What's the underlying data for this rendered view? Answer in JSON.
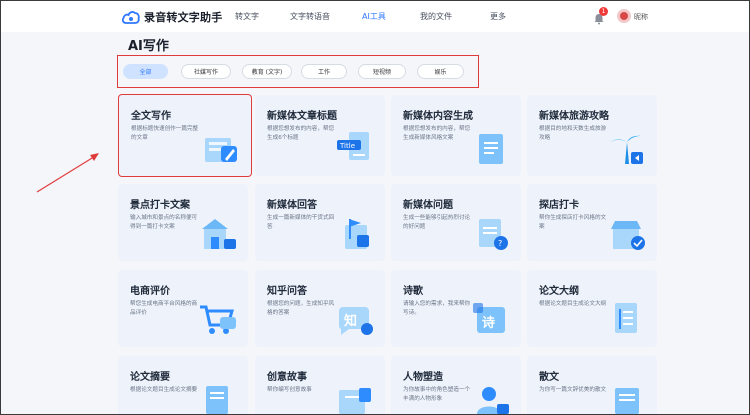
{
  "header": {
    "app_name": "录音转文字助手",
    "nav": [
      "转文字",
      "文字转语音",
      "AI工具",
      "我的文件",
      "更多"
    ],
    "active_nav": "AI工具",
    "notification_count": "1",
    "user_name": "昵称"
  },
  "page": {
    "title": "AI写作"
  },
  "filters": [
    "全部",
    "社媒写作",
    "教育 (文字)",
    "工作",
    "短视频",
    "娱乐"
  ],
  "cards": [
    {
      "title": "全文写作",
      "desc": "根据标题快速创作一篇完整的文章",
      "icon": "book-pen-icon"
    },
    {
      "title": "新媒体文章标题",
      "desc": "根据您想发布的内容，帮您生成6个标题",
      "icon": "title-doc-icon"
    },
    {
      "title": "新媒体内容生成",
      "desc": "根据您想发布的内容，帮您生成新媒体风格文案",
      "icon": "document-icon"
    },
    {
      "title": "新媒体旅游攻略",
      "desc": "根据目的地和天数生成旅游攻略",
      "icon": "palm-tree-icon"
    },
    {
      "title": "景点打卡文案",
      "desc": "输入城市和景点的名称便可得到一篇打卡文案",
      "icon": "building-icon"
    },
    {
      "title": "新媒体回答",
      "desc": "生成一篇新媒体的干货式回答",
      "icon": "flag-doc-icon"
    },
    {
      "title": "新媒体问题",
      "desc": "生成一些能够引起热烈讨论的好问题",
      "icon": "question-doc-icon"
    },
    {
      "title": "探店打卡",
      "desc": "帮你生成探店打卡风格的文案",
      "icon": "shop-check-icon"
    },
    {
      "title": "电商评价",
      "desc": "帮您生成电商平台风格的商品评价",
      "icon": "cart-chat-icon"
    },
    {
      "title": "知乎问答",
      "desc": "根据您的问题，生成知乎风格的答案",
      "icon": "zhihu-chat-icon"
    },
    {
      "title": "诗歌",
      "desc": "请输入您的需求，我来帮你写诗。",
      "icon": "poem-icon"
    },
    {
      "title": "论文大纲",
      "desc": "根据论文题目生成论文大纲",
      "icon": "outline-doc-icon"
    },
    {
      "title": "论文摘要",
      "desc": "根据论文题目生成论文摘要",
      "icon": "abstract-doc-icon"
    },
    {
      "title": "创意故事",
      "desc": "帮你编写创意故事",
      "icon": "story-icon"
    },
    {
      "title": "人物塑造",
      "desc": "为你故事中的角色塑造一个丰满的人物形象",
      "icon": "person-icon"
    },
    {
      "title": "散文",
      "desc": "为你写一篇文辞优美的散文",
      "icon": "prose-doc-icon"
    }
  ],
  "colors": {
    "accent": "#2f78ff",
    "highlight": "#e03b3b",
    "card_bg": "#eef3fb",
    "page_bg": "#f4f6fa"
  }
}
